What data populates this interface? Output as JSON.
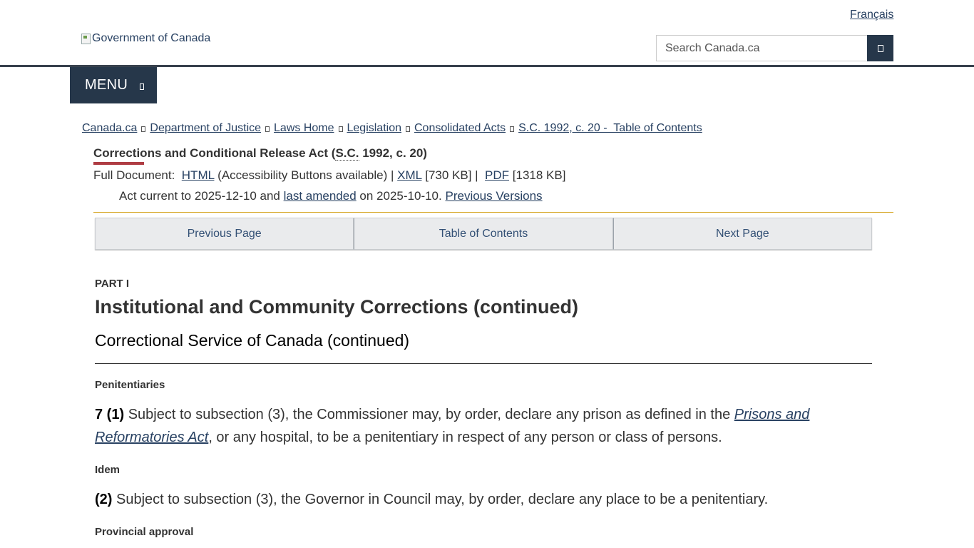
{
  "header": {
    "language_link": "Français",
    "logo_alt": "Government of Canada",
    "search_placeholder": "Search Canada.ca",
    "menu_label": "MENU"
  },
  "breadcrumb": [
    "Canada.ca",
    "Department of Justice",
    "Laws Home",
    "Legislation",
    "Consolidated Acts",
    "S.C. 1992, c. 20 -  Table of Contents"
  ],
  "act": {
    "title_main": "Corrections and Conditional Release Act (",
    "title_abbr": "S.C.",
    "title_end": " 1992, c. 20)",
    "full_document_label": "Full Document:",
    "html_link": "HTML",
    "html_note": "(Accessibility Buttons available) |",
    "xml_link": "XML",
    "xml_size": "[730 KB] |",
    "pdf_link": "PDF",
    "pdf_size": "[1318 KB]",
    "current_prefix": "Act current to 2025-12-10 and",
    "last_amended_link": "last amended",
    "current_suffix": "on 2025-10-10.",
    "previous_versions_link": "Previous Versions"
  },
  "nav": {
    "previous": "Previous Page",
    "toc": "Table of Contents",
    "next": "Next Page"
  },
  "content": {
    "part_label": "PART I",
    "part_title": "Institutional and Community Corrections (continued)",
    "division_title": "Correctional Service of Canada (continued)",
    "marginal_1": "Penitentiaries",
    "s7_1_num": "7 (1)",
    "s7_1_text_a": "Subject to subsection (3), the Commissioner may, by order, declare any prison as defined in the",
    "s7_1_link": "Prisons and Reformatories Act",
    "s7_1_text_b": ", or any hospital, to be a penitentiary in respect of any person or class of persons.",
    "marginal_2": "Idem",
    "s7_2_num": "(2)",
    "s7_2_text": "Subject to subsection (3), the Governor in Council may, by order, declare any place to be a penitentiary.",
    "marginal_3": "Provincial approval"
  }
}
